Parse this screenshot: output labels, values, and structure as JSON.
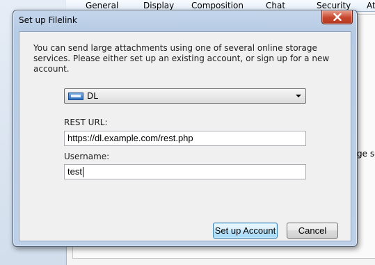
{
  "background": {
    "tabs": [
      "General",
      "Display",
      "Composition",
      "Chat",
      "Security",
      "At"
    ],
    "partial_text": "ge se"
  },
  "dialog": {
    "title": "Set up Filelink",
    "intro": "You can send large attachments using one of several online storage services. Please either set up an existing account, or sign up for a new account.",
    "provider": {
      "selected": "DL",
      "icon": "dl-provider-icon"
    },
    "fields": {
      "rest_url_label": "REST URL:",
      "rest_url_value": "https://dl.example.com/rest.php",
      "username_label": "Username:",
      "username_value": "test"
    },
    "buttons": {
      "setup_label": "Set up Account",
      "cancel_label": "Cancel"
    }
  },
  "colors": {
    "close_button": "#c7452c",
    "default_button_border": "#3c7fb1",
    "dialog_frame": "#b7cbe4"
  }
}
